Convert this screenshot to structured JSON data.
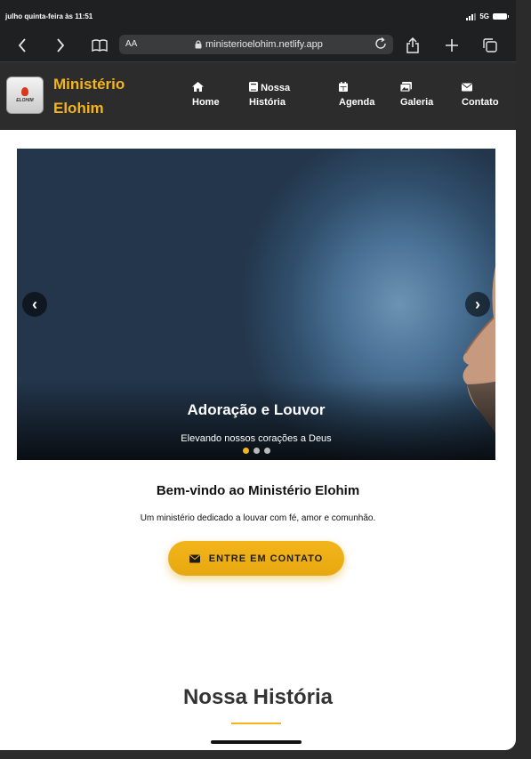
{
  "status_bar": {
    "time": "julho quinta-feira às 11:51",
    "network": "5G"
  },
  "browser": {
    "text_size_label": "AA",
    "url": "ministerioelohim.netlify.app",
    "icons": [
      "back-icon",
      "forward-icon",
      "bookmarks-icon",
      "lock-icon",
      "reload-icon",
      "share-icon",
      "new-tab-icon",
      "tabs-icon"
    ]
  },
  "site": {
    "brand_line1": "Ministério",
    "brand_line2": "Elohim",
    "logo_text": "ELOHIM",
    "nav": [
      {
        "label": "Home",
        "icon": "home-icon"
      },
      {
        "label_line1": "Nossa",
        "label_line2": "História",
        "icon": "book-icon"
      },
      {
        "label": "Agenda",
        "icon": "calendar-icon"
      },
      {
        "label": "Galeria",
        "icon": "images-icon"
      },
      {
        "label": "Contato",
        "icon": "envelope-icon"
      }
    ]
  },
  "carousel": {
    "title": "Adoração e Louvor",
    "subtitle": "Elevando nossos corações a Deus",
    "prev": "‹",
    "next": "›",
    "slides_count": 3,
    "active_index": 0
  },
  "welcome": {
    "heading": "Bem-vindo ao Ministério Elohim",
    "tagline": "Um ministério dedicado a louvar com fé, amor e comunhão.",
    "cta_label": "ENTRE EM CONTATO"
  },
  "history": {
    "heading": "Nossa História"
  },
  "colors": {
    "accent": "#f3b41c",
    "header_bg": "#2c2c2c",
    "browser_bg": "#1f2021"
  }
}
